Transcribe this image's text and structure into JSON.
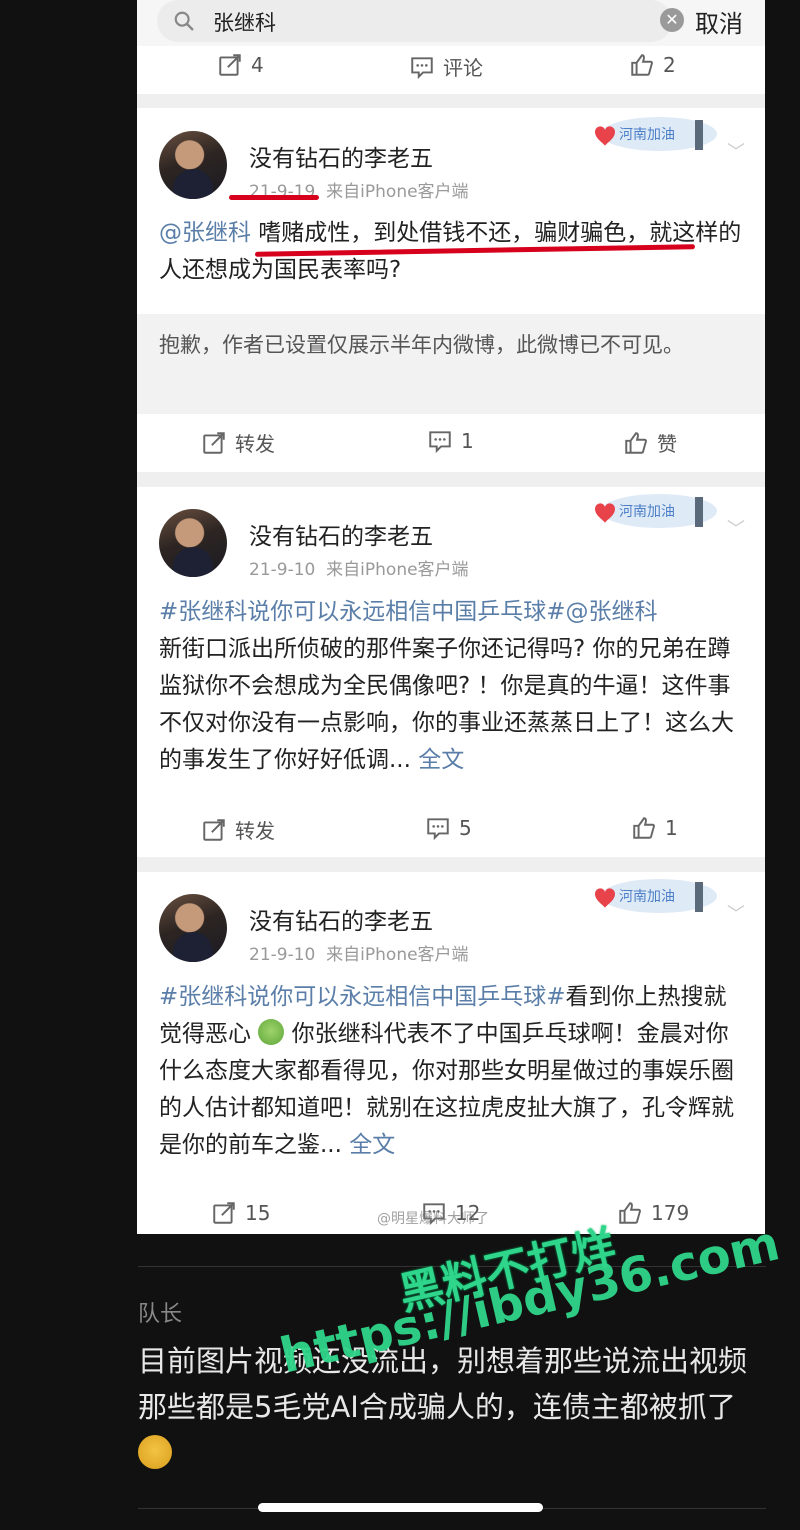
{
  "search": {
    "query": "张继科",
    "cancel_label": "取消"
  },
  "top_actions": {
    "repost_count": "4",
    "comment_label": "评论",
    "like_count": "2"
  },
  "posts": [
    {
      "username": "没有钻石的李老五",
      "date": "21-9-19",
      "source": "来自iPhone客户端",
      "badge_text": "河南加油",
      "mention": "@张继科",
      "text": " 嗜赌成性，到处借钱不还，骗财骗色，就这样的人还想成为国民表率吗?",
      "hidden_note": "抱歉，作者已设置仅展示半年内微博，此微博已不可见。",
      "repost_label": "转发",
      "comment_count": "1",
      "like_label": "赞"
    },
    {
      "username": "没有钻石的李老五",
      "date": "21-9-10",
      "source": "来自iPhone客户端",
      "badge_text": "河南加油",
      "hashtag": "#张继科说你可以永远相信中国乒乓球#@张继科",
      "text": "新街口派出所侦破的那件案子你还记得吗? 你的兄弟在蹲监狱你不会想成为全民偶像吧? ！你是真的牛逼！这件事不仅对你没有一点影响，你的事业还蒸蒸日上了！这么大的事发生了你好好低调...",
      "more_label": "全文",
      "repost_label": "转发",
      "comment_count": "5",
      "like_count": "1"
    },
    {
      "username": "没有钻石的李老五",
      "date": "21-9-10",
      "source": "来自iPhone客户端",
      "badge_text": "河南加油",
      "hashtag": "#张继科说你可以永远相信中国乒乓球#",
      "text_a": "看到你上热搜就觉得恶心",
      "text_b": "你张继科代表不了中国乒乓球啊！金晨对你什么态度大家都看得见，你对那些女明星做过的事娱乐圈的人估计都知道吧！就别在这拉虎皮扯大旗了，孔令辉就是你的前车之鉴...",
      "more_label": "全文",
      "repost_count": "15",
      "comment_count": "12",
      "like_count": "179",
      "image_watermark": "@明星爆料大师了"
    }
  ],
  "comment": {
    "author": "队长",
    "text": "目前图片视频还没流出，别想着那些说流出视频那些都是5毛党AI合成骗人的，连债主都被抓了"
  },
  "overlay_watermark": {
    "line1": "黑料不打烊",
    "line2": "https://ibdy36.com"
  },
  "colors": {
    "link": "#5a7ea8",
    "underline": "#d6001c",
    "watermark": "#2fd58a"
  }
}
